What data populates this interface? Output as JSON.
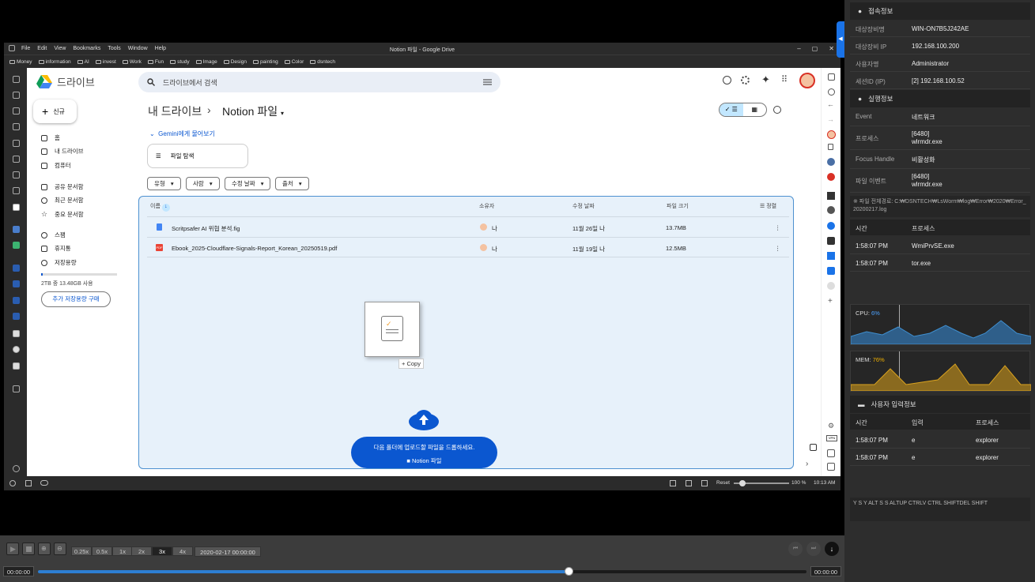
{
  "browser": {
    "menu": [
      "File",
      "Edit",
      "View",
      "Bookmarks",
      "Tools",
      "Window",
      "Help"
    ],
    "title": "Notion 파일 - Google Drive",
    "bookmarks": [
      "Money",
      "information",
      "AI",
      "invest",
      "Work",
      "Fun",
      "study",
      "Image",
      "Design",
      "painting",
      "Color",
      "dsntech"
    ],
    "zoom": "100 %",
    "reset": "Reset",
    "clock": "10:13 AM"
  },
  "drive": {
    "brand": "드라이브",
    "search_placeholder": "드라이브에서 검색",
    "new_label": "신규",
    "nav": [
      "홈",
      "내 드라이브",
      "컴퓨터",
      "공유 문서함",
      "최근 문서함",
      "중요 문서함",
      "스팸",
      "휴지통",
      "저장용량"
    ],
    "storage_text": "2TB 중 13.48GB 사용",
    "buy_storage": "추가 저장용량 구매",
    "breadcrumb_root": "내 드라이브",
    "breadcrumb_sep": "›",
    "breadcrumb_current": "Notion 파일",
    "gemini": "Gemini에게 물어보기",
    "explore": "파일 탐색",
    "filters": [
      "유형",
      "사람",
      "수정 날짜",
      "출처"
    ],
    "columns": {
      "name": "이름",
      "owner": "소유자",
      "modified": "수정 날짜",
      "size": "파일 크기",
      "sort": "정렬"
    },
    "files": [
      {
        "name": "Scritpsafer  AI 위협 분석.fig",
        "owner": "나",
        "modified": "11월 26일 나",
        "size": "13.7MB",
        "type": "doc"
      },
      {
        "name": "Ebook_2025-Cloudflare-Signals-Report_Korean_20250519.pdf",
        "owner": "나",
        "modified": "11월 19일 나",
        "size": "12.5MB",
        "type": "pdf"
      }
    ],
    "copy_label": "+ Copy",
    "upload_msg": "다음 폴더에 업로드할 파일을 드롭하세요.",
    "upload_folder": "Notion 파일"
  },
  "player": {
    "speeds": [
      "0.25x",
      "0.5x",
      "1x",
      "2x",
      "3x",
      "4x"
    ],
    "active_speed": "3x",
    "datetime": "2020-02-17 00:00:00",
    "time_start": "00:00:00",
    "time_end": "00:00:00",
    "progress": 0.69
  },
  "panel": {
    "conn_title": "접속정보",
    "conn": [
      {
        "k": "대상장비명",
        "v": "WIN-ON7B5J242AE"
      },
      {
        "k": "대상장비 IP",
        "v": "192.168.100.200"
      },
      {
        "k": "사용자명",
        "v": "Administrator"
      },
      {
        "k": "세션ID (IP)",
        "v": "[2] 192.168.100.52"
      }
    ],
    "exec_title": "실행정보",
    "exec": [
      {
        "k": "Event",
        "v": "네트워크"
      },
      {
        "k": "프로세스",
        "v": "[6480]\nwlrmdr.exe"
      },
      {
        "k": "Focus Handle",
        "v": "비활성화"
      },
      {
        "k": "파일 이벤트",
        "v": "[6480]\nwlrmdr.exe"
      }
    ],
    "path": "※ 파일 전체경로: C:₩DSNTECH₩LsWorm₩log₩Error₩2020₩Error_20200217.log",
    "proc_header": {
      "time": "시간",
      "proc": "프로세스"
    },
    "procs": [
      {
        "time": "1:58:07 PM",
        "proc": "WmiPrvSE.exe"
      },
      {
        "time": "1:58:07 PM",
        "proc": "tor.exe"
      }
    ],
    "cpu_label": "CPU:",
    "cpu_value": "6%",
    "mem_label": "MEM:",
    "mem_value": "76%",
    "input_title": "사용자 입력정보",
    "input_header": {
      "time": "시간",
      "input": "입력",
      "proc": "프로세스"
    },
    "inputs": [
      {
        "time": "1:58:07 PM",
        "input": "e",
        "proc": "explorer"
      },
      {
        "time": "1:58:07 PM",
        "input": "e",
        "proc": "explorer"
      }
    ],
    "keys": "Y S Y ALT S S ALTUP CTRLV CTRL SHIFTDEL SHIFT",
    "colors": {
      "cpu": "#2f7fc0",
      "mem": "#d9a21f",
      "accent": "#0b57d0"
    }
  }
}
